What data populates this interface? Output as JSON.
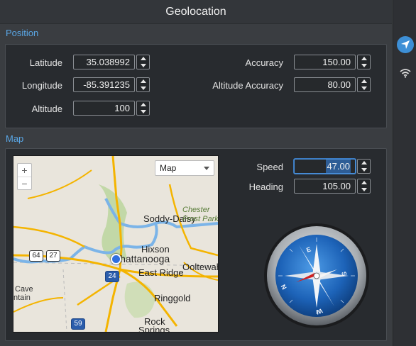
{
  "window": {
    "title": "Geolocation"
  },
  "position": {
    "section_label": "Position",
    "latitude": {
      "label": "Latitude",
      "value": "35.038992"
    },
    "longitude": {
      "label": "Longitude",
      "value": "-85.391235"
    },
    "altitude": {
      "label": "Altitude",
      "value": "100"
    },
    "accuracy": {
      "label": "Accuracy",
      "value": "150.00"
    },
    "altitude_accuracy": {
      "label": "Altitude Accuracy",
      "value": "80.00"
    }
  },
  "map_section": {
    "section_label": "Map",
    "map": {
      "type_select": "Map",
      "zoom_in": "+",
      "zoom_out": "−",
      "places": [
        "Soddy-Daisy",
        "Chester",
        "Frost Park",
        "Hixson",
        "Ooltewah",
        "Chattanooga",
        "East Ridge",
        "Ringgold",
        "Rock",
        "Springs",
        "Cave",
        "ntain"
      ],
      "shields": [
        "64",
        "27",
        "24",
        "59"
      ]
    },
    "speed": {
      "label": "Speed",
      "value": "47.00"
    },
    "heading": {
      "label": "Heading",
      "value": "105.00"
    },
    "compass_letters": {
      "n": "N",
      "e": "E",
      "s": "S",
      "w": "W"
    }
  },
  "rail": {
    "icons": [
      "location-arrow-icon",
      "wifi-icon"
    ]
  },
  "colors": {
    "accent": "#5aa7e6",
    "selected": "#3d8fd6",
    "compass_blue": "#1d63b8",
    "compass_red": "#d22020"
  }
}
